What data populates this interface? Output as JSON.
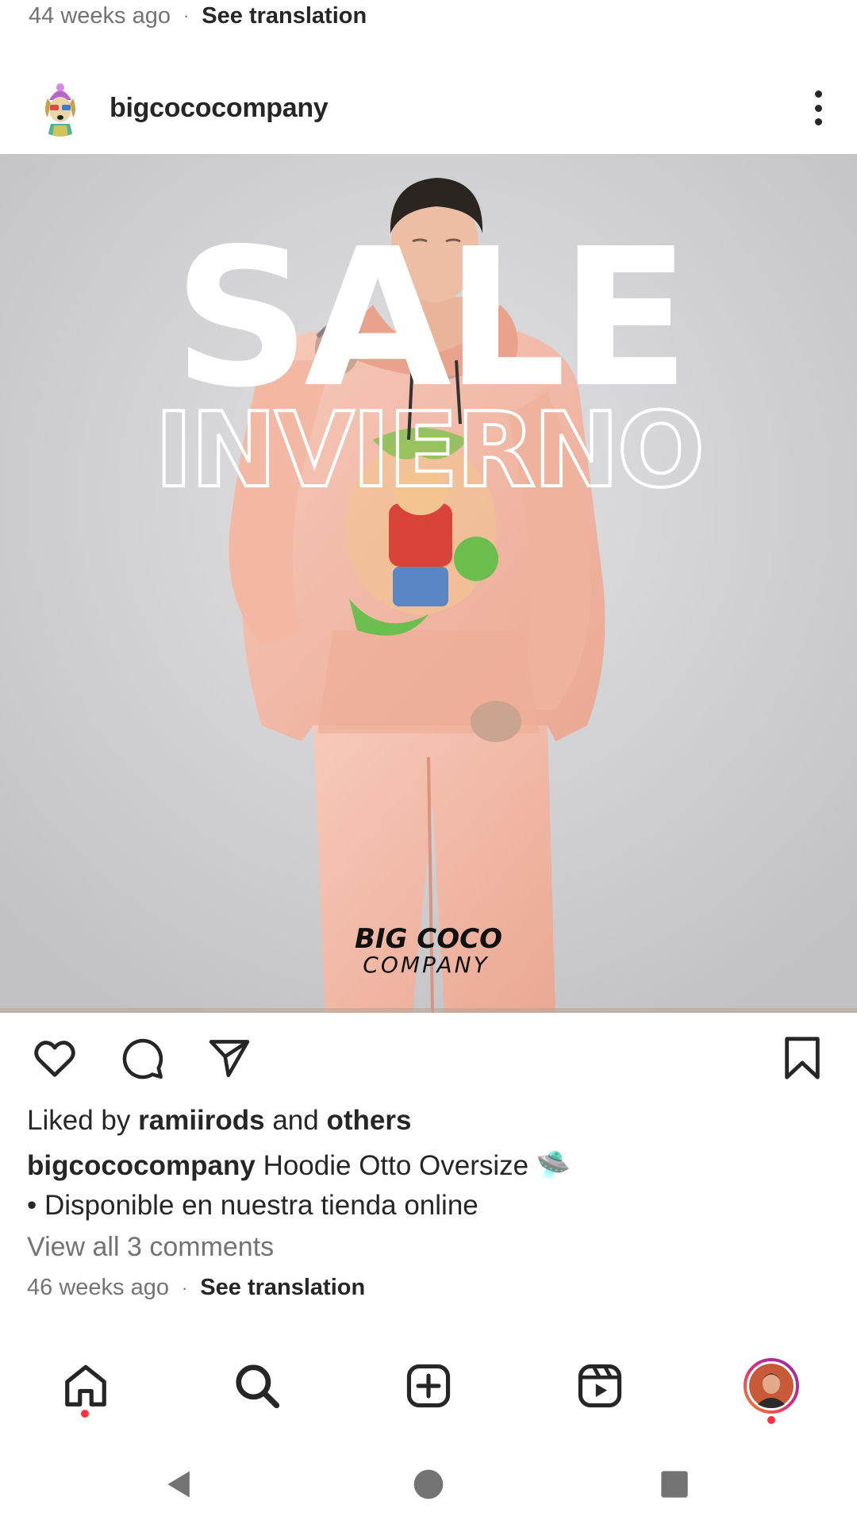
{
  "previous_post": {
    "timestamp": "44 weeks ago",
    "separator": "·",
    "see_translation": "See translation"
  },
  "post": {
    "username": "bigcococompany",
    "image": {
      "headline": "SALE",
      "subheadline": "INVIERNO",
      "brand_top": "BIG COCO",
      "brand_bottom": "COMPANY"
    },
    "likes": {
      "prefix": "Liked by",
      "user": "ramiirods",
      "conj": "and",
      "others": "others"
    },
    "caption": {
      "user": "bigcococompany",
      "text": "Hoodie Otto Oversize",
      "emoji": "🛸",
      "line2": "• Disponible en nuestra tienda online"
    },
    "comments_link": "View all 3 comments",
    "timestamp": "46 weeks ago",
    "separator": "·",
    "see_translation": "See translation"
  },
  "icons": {
    "like": "heart-icon",
    "comment": "comment-icon",
    "share": "paper-plane-icon",
    "save": "bookmark-icon",
    "more": "more-vertical-icon"
  },
  "bottom_nav": {
    "items": [
      "home",
      "search",
      "create",
      "reels",
      "profile"
    ],
    "notification_color": "#ff3040"
  },
  "system_nav": [
    "back",
    "home",
    "recents"
  ],
  "colors": {
    "text": "#262626",
    "secondary": "#737373",
    "notification": "#ff3040",
    "profile_ring": "#c13584",
    "hoodie": "#f4bfae",
    "image_bg": "#cfcfd1"
  }
}
